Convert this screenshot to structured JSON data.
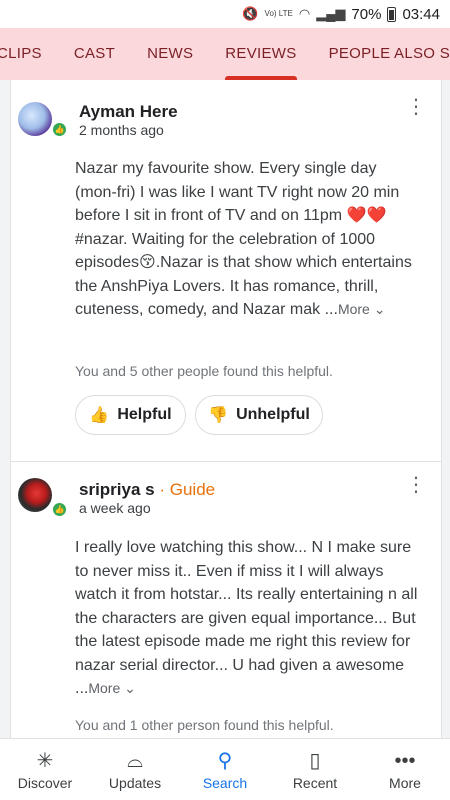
{
  "status": {
    "battery": "70%",
    "time": "03:44",
    "network": "Vo) LTE"
  },
  "tabs": [
    {
      "label": "CLIPS"
    },
    {
      "label": "CAST"
    },
    {
      "label": "NEWS"
    },
    {
      "label": "REVIEWS",
      "active": true
    },
    {
      "label": "PEOPLE ALSO SEARCH F"
    }
  ],
  "reviews": [
    {
      "author": "Ayman Here",
      "time": "2 months ago",
      "text": "Nazar my favourite show. Every single day (mon-fri) I was like I want TV right now 20 min before I sit in front of TV and on 11pm ❤️❤️ #nazar. Waiting for the celebration of 1000 episodes😚.Nazar is that show which entertains the AnshPiya Lovers. It has romance, thrill, cuteness, comedy, and Nazar mak ...",
      "more": "More",
      "helpful_count": "You and 5 other people found this helpful.",
      "helpful_label": "Helpful",
      "unhelpful_label": "Unhelpful"
    },
    {
      "author": "sripriya s",
      "badge": "Guide",
      "separator": "·",
      "time": "a week ago",
      "text": "I really love watching this show...  N I make sure to never miss it.. Even if miss it I will always watch it from hotstar... Its really entertaining n all the characters are given equal importance...  But the latest episode made me right this review for nazar serial director... U had given a awesome ...",
      "more": "More",
      "helpful_count": "You and 1 other person found this helpful."
    }
  ],
  "bottom_nav": [
    {
      "label": "Discover",
      "icon": "asterisk-icon"
    },
    {
      "label": "Updates",
      "icon": "updates-icon"
    },
    {
      "label": "Search",
      "icon": "search-icon",
      "active": true
    },
    {
      "label": "Recent",
      "icon": "recent-icon"
    },
    {
      "label": "More",
      "icon": "more-dots-icon"
    }
  ]
}
